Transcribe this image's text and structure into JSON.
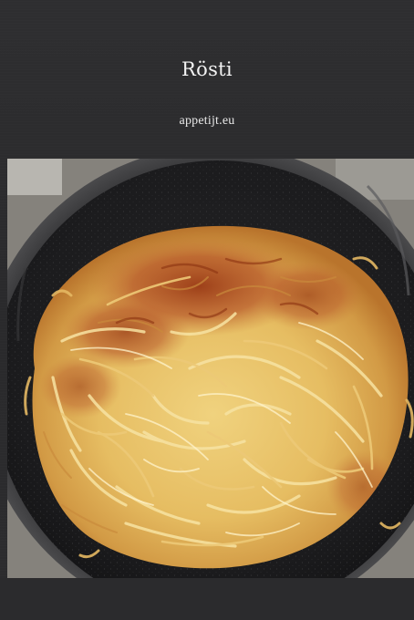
{
  "page": {
    "title": "Rösti",
    "subtitle": "appetijt.eu"
  },
  "photo": {
    "subject": "rösti-in-frying-pan"
  },
  "colors": {
    "background": "#2b2b2d",
    "title_text": "#f2f2f2",
    "pan": "#1c1c1e",
    "rosti_base": "#e2b85c",
    "rosti_browned": "#a8441a"
  }
}
